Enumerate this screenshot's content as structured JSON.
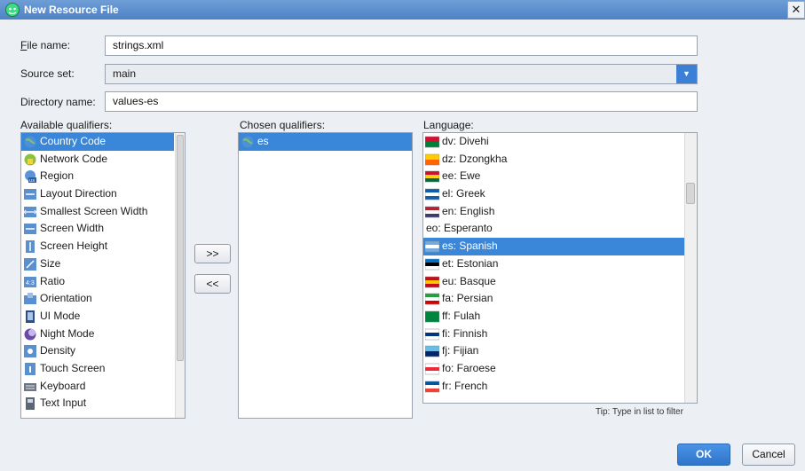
{
  "window": {
    "title": "New Resource File",
    "close_label": "✕"
  },
  "form": {
    "file_name_label": "File name:",
    "file_name_value": "strings.xml",
    "source_set_label": "Source set:",
    "source_set_value": "main",
    "directory_label": "Directory name:",
    "directory_value": "values-es"
  },
  "qualifiers": {
    "available_label": "Available qualifiers:",
    "chosen_label": "Chosen qualifiers:",
    "language_label": "Language:",
    "available": [
      {
        "label": "Country Code",
        "icon": "globe-icon",
        "selected": true
      },
      {
        "label": "Network Code",
        "icon": "network-icon"
      },
      {
        "label": "Region",
        "icon": "region-icon"
      },
      {
        "label": "Layout Direction",
        "icon": "layout-direction-icon"
      },
      {
        "label": "Smallest Screen Width",
        "icon": "smallest-width-icon"
      },
      {
        "label": "Screen Width",
        "icon": "screen-width-icon"
      },
      {
        "label": "Screen Height",
        "icon": "screen-height-icon"
      },
      {
        "label": "Size",
        "icon": "size-icon"
      },
      {
        "label": "Ratio",
        "icon": "ratio-icon"
      },
      {
        "label": "Orientation",
        "icon": "orientation-icon"
      },
      {
        "label": "UI Mode",
        "icon": "ui-mode-icon"
      },
      {
        "label": "Night Mode",
        "icon": "night-mode-icon"
      },
      {
        "label": "Density",
        "icon": "density-icon"
      },
      {
        "label": "Touch Screen",
        "icon": "touch-screen-icon"
      },
      {
        "label": "Keyboard",
        "icon": "keyboard-icon"
      },
      {
        "label": "Text Input",
        "icon": "text-input-icon"
      }
    ],
    "chosen": [
      {
        "label": "es",
        "icon": "globe-icon"
      }
    ],
    "languages": [
      {
        "label": "dv: Divehi",
        "flag": [
          "#d21034",
          "#007e3a"
        ]
      },
      {
        "label": "dz: Dzongkha",
        "flag": [
          "#ffcc00",
          "#ff6600"
        ]
      },
      {
        "label": "ee: Ewe",
        "flag": [
          "#ce1126",
          "#fcd116",
          "#006b3f"
        ]
      },
      {
        "label": "el: Greek",
        "flag": [
          "#0d5eaf",
          "#ffffff",
          "#0d5eaf"
        ]
      },
      {
        "label": "en: English",
        "flag": [
          "#b22234",
          "#ffffff",
          "#3c3b6e"
        ]
      },
      {
        "label": "eo: Esperanto",
        "flag": []
      },
      {
        "label": "es: Spanish",
        "flag": [
          "#74acdf",
          "#ffffff",
          "#74acdf"
        ],
        "selected": true
      },
      {
        "label": "et: Estonian",
        "flag": [
          "#0072ce",
          "#000000",
          "#ffffff"
        ]
      },
      {
        "label": "eu: Basque",
        "flag": [
          "#c60b1e",
          "#ffc400",
          "#c60b1e"
        ]
      },
      {
        "label": "fa: Persian",
        "flag": [
          "#239f40",
          "#ffffff",
          "#da0000"
        ]
      },
      {
        "label": "ff: Fulah",
        "flag": [
          "#00853f",
          "#00853f"
        ]
      },
      {
        "label": "fi: Finnish",
        "flag": [
          "#ffffff",
          "#003580",
          "#ffffff"
        ]
      },
      {
        "label": "fj: Fijian",
        "flag": [
          "#68bfe5",
          "#002868"
        ]
      },
      {
        "label": "fo: Faroese",
        "flag": [
          "#ffffff",
          "#ed2939",
          "#ffffff"
        ]
      },
      {
        "label": "fr: French",
        "flag": [
          "#0055a4",
          "#ffffff",
          "#ef4135"
        ]
      }
    ]
  },
  "buttons": {
    "add": ">>",
    "remove": "<<",
    "ok": "OK",
    "cancel": "Cancel"
  },
  "tip": "Tip: Type in list to filter",
  "colors": {
    "selection": "#3a86d8",
    "title_bar": "#4d82c6",
    "ok_button": "#2f75cb"
  }
}
